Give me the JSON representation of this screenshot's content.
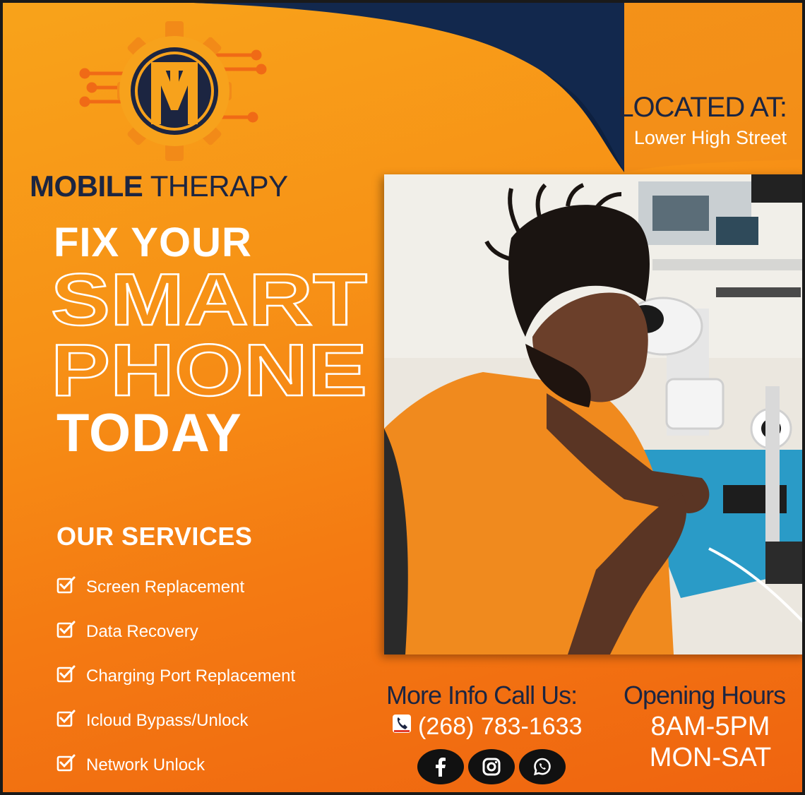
{
  "brand": {
    "bold": "MOBILE",
    "light": " THERAPY",
    "logo_letters": "TM",
    "logo_icon": "gear-circuit-logo-icon"
  },
  "headline": {
    "line1": "FIX YOUR",
    "line2": "SMART",
    "line3": "PHONE",
    "line4": "TODAY"
  },
  "location": {
    "title": "LOCATED AT:",
    "address": "Lower High Street"
  },
  "services": {
    "title": "OUR SERVICES",
    "checkbox_icon": "checkbox-checked-icon",
    "items": [
      {
        "label": "Screen Replacement"
      },
      {
        "label": "Data Recovery"
      },
      {
        "label": "Charging Port Replacement"
      },
      {
        "label": "Icloud Bypass/Unlock"
      },
      {
        "label": "Network Unlock"
      }
    ]
  },
  "contact": {
    "title": "More Info Call Us:",
    "phone": "(268) 783-1633",
    "phone_icon": "phone-icon"
  },
  "hours": {
    "title": "Opening Hours",
    "time": "8AM-5PM",
    "days": "MON-SAT"
  },
  "social": [
    {
      "icon": "facebook-icon"
    },
    {
      "icon": "instagram-icon"
    },
    {
      "icon": "whatsapp-icon"
    }
  ],
  "photo": {
    "icon": "technician-photo"
  },
  "colors": {
    "navy": "#1c2541",
    "orange": "#f79216",
    "deep_orange": "#ef6410",
    "white": "#ffffff"
  }
}
